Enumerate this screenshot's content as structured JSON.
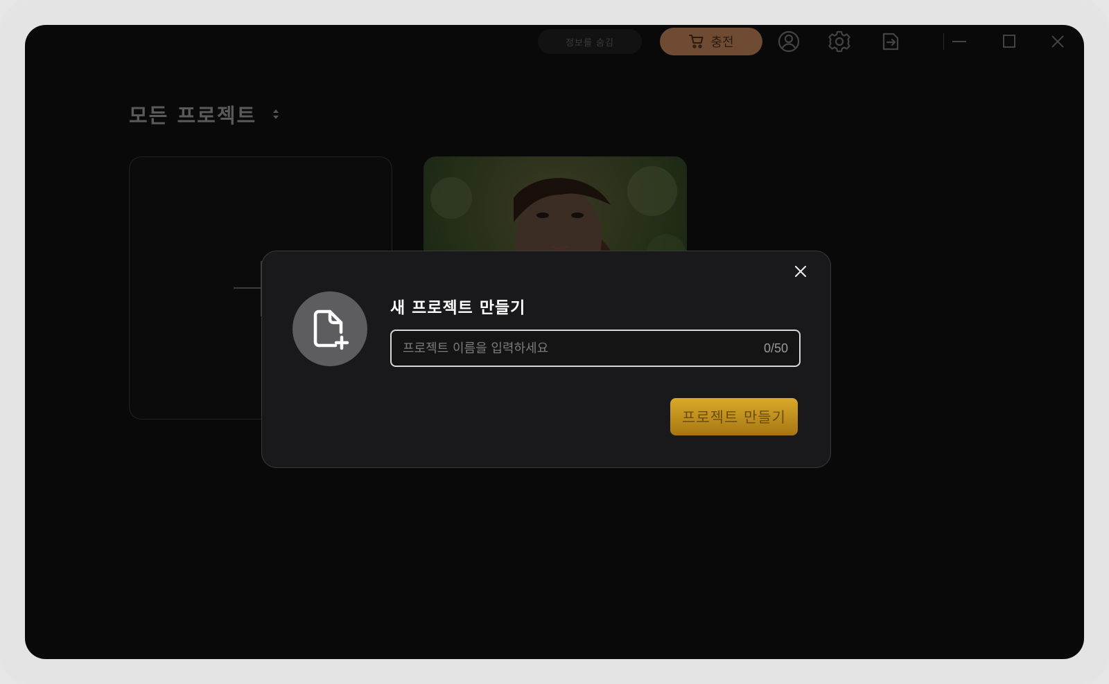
{
  "titlebar": {
    "blurred_label": "정보를 숨김",
    "charge_label": "충전",
    "icons": [
      "cart-icon",
      "account-icon",
      "settings-icon",
      "logout-icon",
      "minimize-icon",
      "maximize-icon",
      "close-icon"
    ]
  },
  "content": {
    "heading": "모든 프로젝트"
  },
  "dialog": {
    "title": "새 프로젝트 만들기",
    "input_placeholder": "프로젝트 이름을 입력하세요",
    "input_value": "",
    "counter": "0/50",
    "create_label": "프로젝트 만들기"
  },
  "colors": {
    "accent_gold": "#d9a92a",
    "charge_brown": "#6f4b33",
    "background": "#090909"
  }
}
